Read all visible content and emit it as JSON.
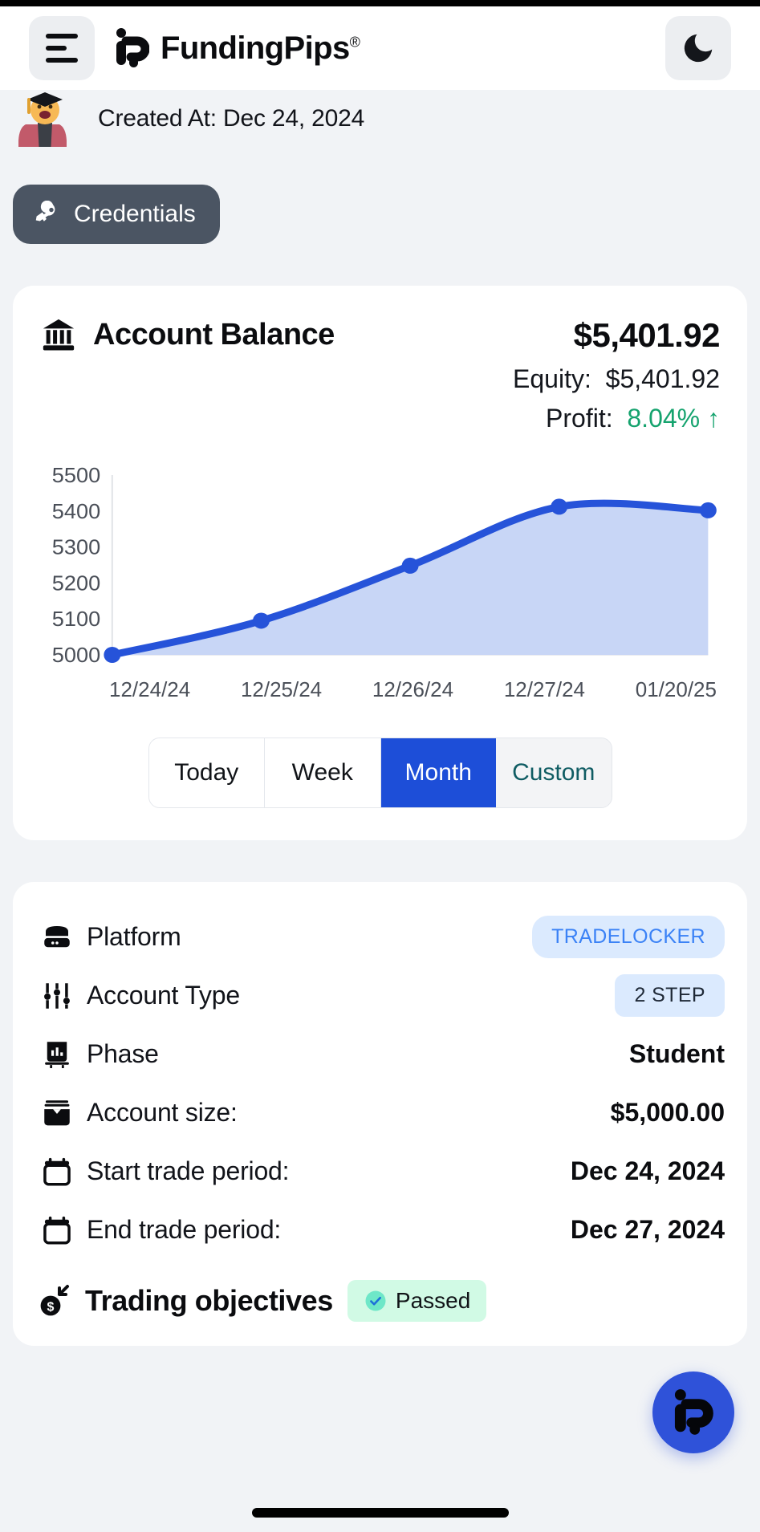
{
  "header": {
    "menu_icon": "hamburger-icon",
    "brand_name": "FundingPips",
    "brand_registered": "®",
    "theme_icon": "moon-icon"
  },
  "account_meta": {
    "avatar_icon": "student-avatar",
    "created_at": "Created At: Dec 24, 2024",
    "credentials_label": "Credentials",
    "credentials_icon": "key-icon"
  },
  "balance_card": {
    "icon": "bank-icon",
    "title": "Account Balance",
    "amount": "$5,401.92",
    "equity_label": "Equity:",
    "equity_value": "$5,401.92",
    "profit_label": "Profit:",
    "profit_value": "8.04%",
    "profit_arrow": "↑",
    "profit_color": "#15a36e"
  },
  "period_tabs": [
    {
      "label": "Today",
      "state": "inactive"
    },
    {
      "label": "Week",
      "state": "inactive"
    },
    {
      "label": "Month",
      "state": "active"
    },
    {
      "label": "Custom",
      "state": "muted"
    }
  ],
  "details": {
    "rows": [
      {
        "icon": "server-icon",
        "label": "Platform",
        "value": "TRADELOCKER",
        "kind": "badge-platform"
      },
      {
        "icon": "sliders-icon",
        "label": "Account Type",
        "value": "2 STEP",
        "kind": "badge-acct"
      },
      {
        "icon": "chart-icon",
        "label": "Phase",
        "value": "Student",
        "kind": "text"
      },
      {
        "icon": "wallet-icon",
        "label": "Account size:",
        "value": "$5,000.00",
        "kind": "text"
      },
      {
        "icon": "calendar-icon",
        "label": "Start trade period:",
        "value": "Dec 24, 2024",
        "kind": "text"
      },
      {
        "icon": "calendar-icon",
        "label": "End trade period:",
        "value": "Dec 27, 2024",
        "kind": "text"
      }
    ],
    "objectives_icon": "coin-in-icon",
    "objectives_title": "Trading objectives",
    "objectives_status": "Passed",
    "objectives_status_icon": "check-circle-icon"
  },
  "fab": {
    "icon": "fundingpips-logo-icon"
  },
  "colors": {
    "accent_blue": "#1d4ed8",
    "line_blue": "#2653d9",
    "area_blue": "#c5d4f5",
    "profit_green": "#15a36e",
    "dark_pill": "#4b5563",
    "page_bg": "#f1f3f6"
  },
  "chart_data": {
    "type": "area",
    "title": "Account Balance",
    "x": [
      "12/24/24",
      "12/25/24",
      "12/26/24",
      "12/27/24",
      "01/20/25"
    ],
    "values": [
      5000,
      5095,
      5248,
      5412,
      5402
    ],
    "ylabel": "",
    "xlabel": "",
    "ytick_labels": [
      "5500",
      "5400",
      "5300",
      "5200",
      "5100",
      "5000"
    ],
    "yticks": [
      5500,
      5400,
      5300,
      5200,
      5100,
      5000
    ],
    "ylim": [
      5000,
      5500
    ],
    "grid": false,
    "legend": "none",
    "series": [
      {
        "name": "Balance",
        "values": [
          5000,
          5095,
          5248,
          5412,
          5402
        ],
        "color": "#2653d9"
      }
    ]
  }
}
